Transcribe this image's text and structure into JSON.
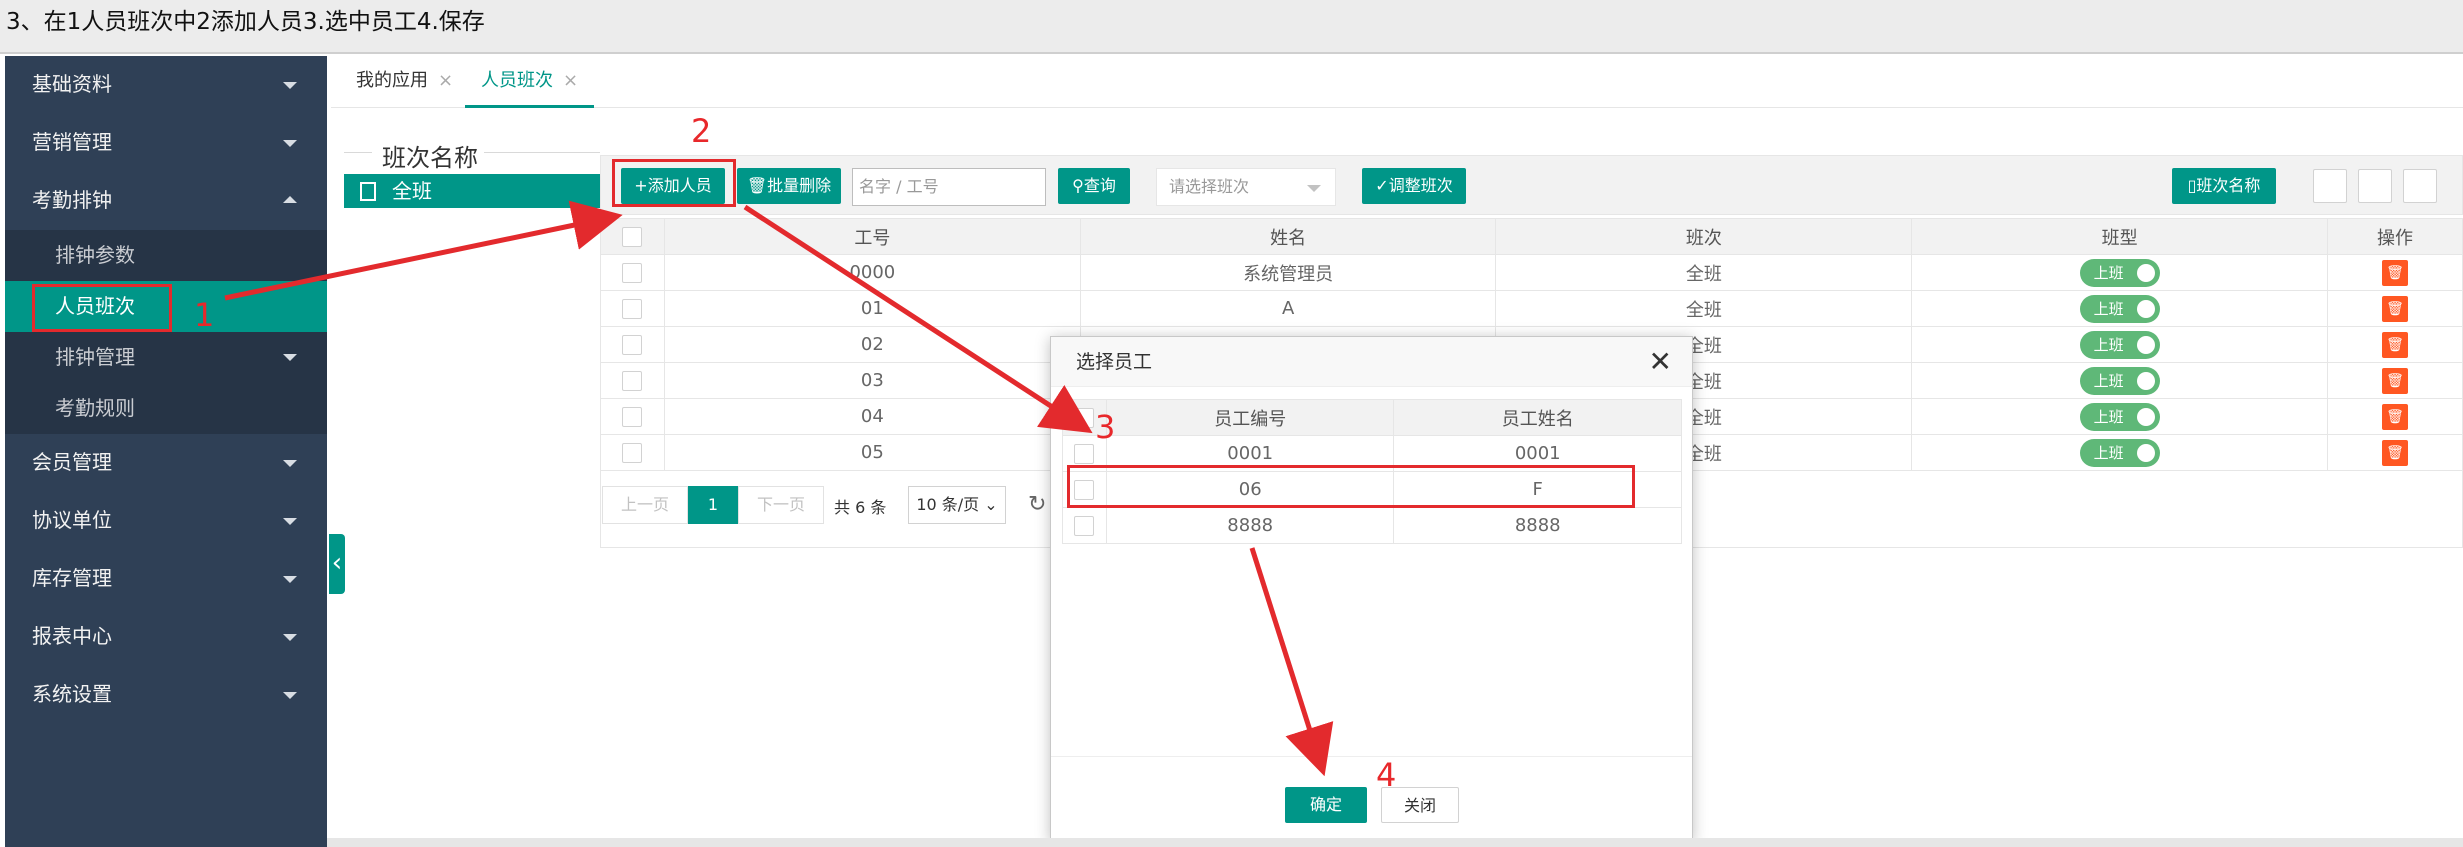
{
  "caption": "3、在1人员班次中2添加人员3.选中员工4.保存",
  "sidebar": {
    "menu_top": [
      {
        "label": "基础资料"
      },
      {
        "label": "营销管理"
      },
      {
        "label": "考勤排钟"
      }
    ],
    "submenu": [
      {
        "label": "排钟参数"
      },
      {
        "label": "人员班次"
      },
      {
        "label": "排钟管理"
      },
      {
        "label": "考勤规则"
      }
    ],
    "menu_bottom": [
      {
        "label": "会员管理"
      },
      {
        "label": "协议单位"
      },
      {
        "label": "库存管理"
      },
      {
        "label": "报表中心"
      },
      {
        "label": "系统设置"
      }
    ]
  },
  "tabs": [
    {
      "label": "我的应用",
      "close": "×"
    },
    {
      "label": "人员班次",
      "close": "×"
    }
  ],
  "left_panel": {
    "legend": "班次名称",
    "tree_node": "全班"
  },
  "toolbar": {
    "add_label": "+添加人员",
    "batch_delete_label": "批量删除",
    "search_placeholder": "名字 / 工号",
    "query_label": "查询",
    "shift_select": "请选择班次",
    "adjust_label": "✓调整班次",
    "shift_name_label": "班次名称"
  },
  "table": {
    "headers": [
      "工号",
      "姓名",
      "班次",
      "班型",
      "操作"
    ],
    "rows": [
      {
        "id": "0000",
        "name": "系统管理员",
        "shift": "全班",
        "type": "上班"
      },
      {
        "id": "01",
        "name": "A",
        "shift": "全班",
        "type": "上班"
      },
      {
        "id": "02",
        "name": "",
        "shift": "全班",
        "type": "上班"
      },
      {
        "id": "03",
        "name": "",
        "shift": "全班",
        "type": "上班"
      },
      {
        "id": "04",
        "name": "",
        "shift": "全班",
        "type": "上班"
      },
      {
        "id": "05",
        "name": "",
        "shift": "全班",
        "type": "上班"
      }
    ]
  },
  "pager": {
    "prev": "上一页",
    "current": "1",
    "next": "下一页",
    "total": "共 6 条",
    "page_size": "10 条/页"
  },
  "dialog": {
    "title": "选择员工",
    "close": "✕",
    "headers": [
      "员工编号",
      "员工姓名"
    ],
    "rows": [
      {
        "code": "0001",
        "name": "0001"
      },
      {
        "code": "06",
        "name": "F"
      },
      {
        "code": "8888",
        "name": "8888"
      }
    ],
    "confirm_label": "确定",
    "cancel_label": "关闭"
  },
  "annotations": {
    "step1": "1",
    "step2": "2",
    "step3": "3",
    "step4": "4"
  },
  "colors": {
    "sidebar_bg": "#2f4056",
    "accent": "#009688",
    "switch_on": "#5fb878",
    "danger": "#ff5722",
    "annotation_red": "#e32a2d"
  }
}
